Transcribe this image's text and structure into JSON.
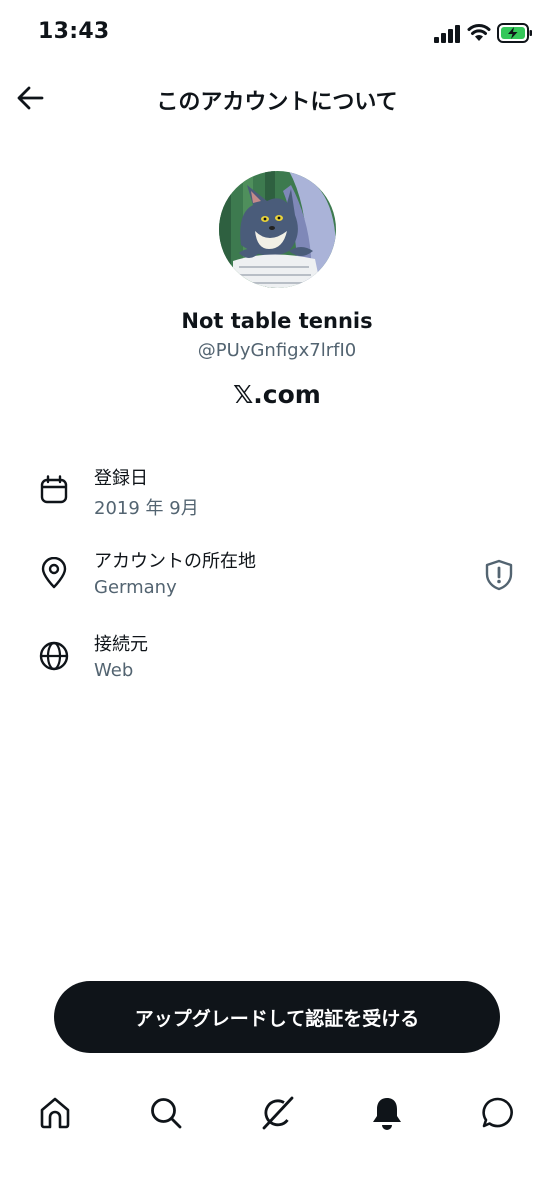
{
  "status_bar": {
    "time": "13:43"
  },
  "header": {
    "title": "このアカウントについて"
  },
  "profile": {
    "display_name": "Not table tennis",
    "handle": "@PUyGnfigx7lrfI0",
    "domain": "𝕏.com"
  },
  "info": [
    {
      "icon": "calendar-icon",
      "label": "登録日",
      "value": "2019 年 9月"
    },
    {
      "icon": "location-pin-icon",
      "label": "アカウントの所在地",
      "value": "Germany"
    },
    {
      "icon": "globe-icon",
      "label": "接続元",
      "value": "Web"
    }
  ],
  "upgrade": {
    "label": "アップグレードして認証を受ける"
  },
  "nav": [
    "home-icon",
    "search-icon",
    "grok-icon",
    "notifications-bell-icon",
    "messages-icon"
  ],
  "colors": {
    "primary_text": "#0f1419",
    "secondary_text": "#536471",
    "battery_charge": "#34c759"
  }
}
